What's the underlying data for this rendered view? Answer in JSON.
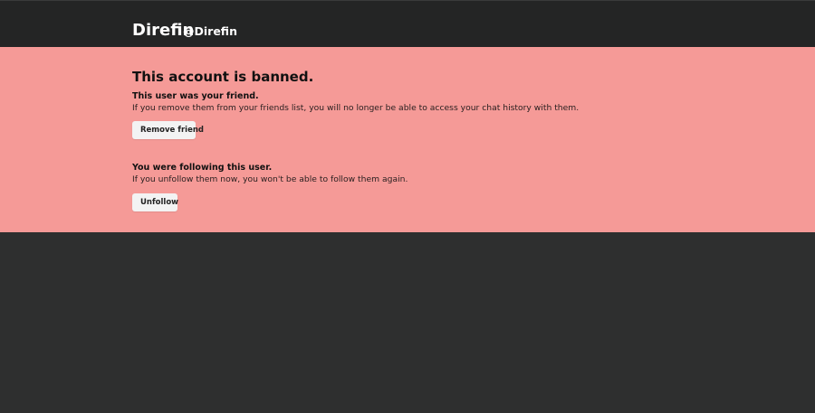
{
  "header": {
    "display_name": "Direfin",
    "handle": "@Direfin"
  },
  "banner": {
    "title": "This account is banned.",
    "friend_section": {
      "title": "This user was your friend.",
      "text": "If you remove them from your friends list, you will no longer be able to access your chat history with them.",
      "button_label": "Remove friend"
    },
    "follow_section": {
      "title": "You were following this user.",
      "text": "If you unfollow them now, you won't be able to follow them again.",
      "button_label": "Unfollow"
    }
  },
  "colors": {
    "header_bg": "#242525",
    "page_bg": "#2e2f2f",
    "banner_bg": "#f59a97",
    "button_bg": "#f3f3f3"
  }
}
